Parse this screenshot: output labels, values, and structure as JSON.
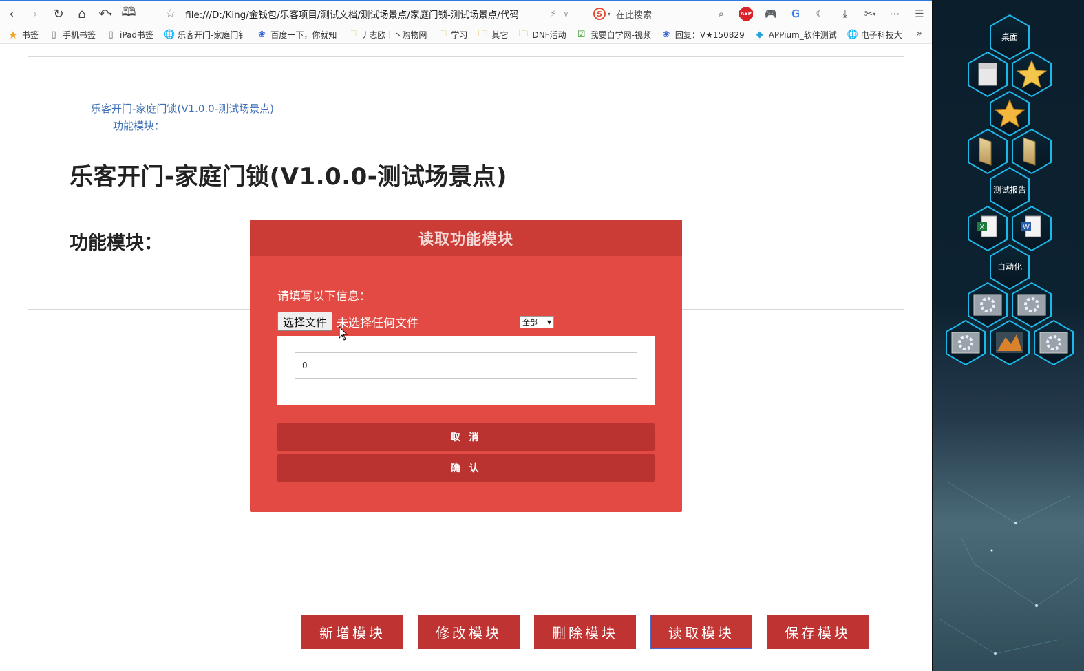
{
  "browser": {
    "url": "file:///D:/King/金钱包/乐客项目/测试文档/测试场景点/家庭门锁-测试场景点/代码",
    "search_placeholder": "在此搜索",
    "search_logo": "S",
    "abp_label": "ABP"
  },
  "bookmarks": [
    {
      "icon": "star-icon",
      "label": "书签"
    },
    {
      "icon": "phone-icon",
      "label": "手机书签"
    },
    {
      "icon": "tablet-icon",
      "label": "iPad书签"
    },
    {
      "icon": "globe-icon",
      "label": "乐客开门-家庭门钅"
    },
    {
      "icon": "baidu-paw-icon",
      "label": "百度一下，你就知"
    },
    {
      "icon": "folder-icon",
      "label": "丿志欧丨丶购物网"
    },
    {
      "icon": "folder-icon",
      "label": "学习"
    },
    {
      "icon": "folder-icon",
      "label": "其它"
    },
    {
      "icon": "folder-icon",
      "label": "DNF活动"
    },
    {
      "icon": "v-check-icon",
      "label": "我要自学网-视频"
    },
    {
      "icon": "paw-icon",
      "label": "回复：V★150829"
    },
    {
      "icon": "appium-icon",
      "label": "APPium_软件测试"
    },
    {
      "icon": "globe-icon",
      "label": "电子科技大"
    }
  ],
  "page": {
    "toc_title": "乐客开门-家庭门锁(V1.0.0-测试场景点)",
    "toc_sub": "功能模块：",
    "heading": "乐客开门-家庭门锁(V1.0.0-测试场景点)",
    "subheading": "功能模块："
  },
  "modal": {
    "title": "读取功能模块",
    "prompt": "请填写以下信息：",
    "file_button": "选择文件",
    "file_status": "未选择任何文件",
    "filter_value": "全部",
    "input_value": "0",
    "cancel_label": "取 消",
    "confirm_label": "确 认"
  },
  "actions": [
    {
      "label": "新增模块"
    },
    {
      "label": "修改模块"
    },
    {
      "label": "删除模块"
    },
    {
      "label": "读取模块",
      "active": true
    },
    {
      "label": "保存模块"
    }
  ],
  "desktop": {
    "label_desktop": "桌面",
    "label_report": "测试报告",
    "label_automation": "自动化",
    "excel_letter": "X",
    "word_letter": "W"
  },
  "colors": {
    "modal_bg": "#e34a43",
    "modal_header": "#cc3c37",
    "button_red": "#bf3432",
    "link_blue": "#3d6fb5",
    "hex_glow": "#1db7e8"
  }
}
